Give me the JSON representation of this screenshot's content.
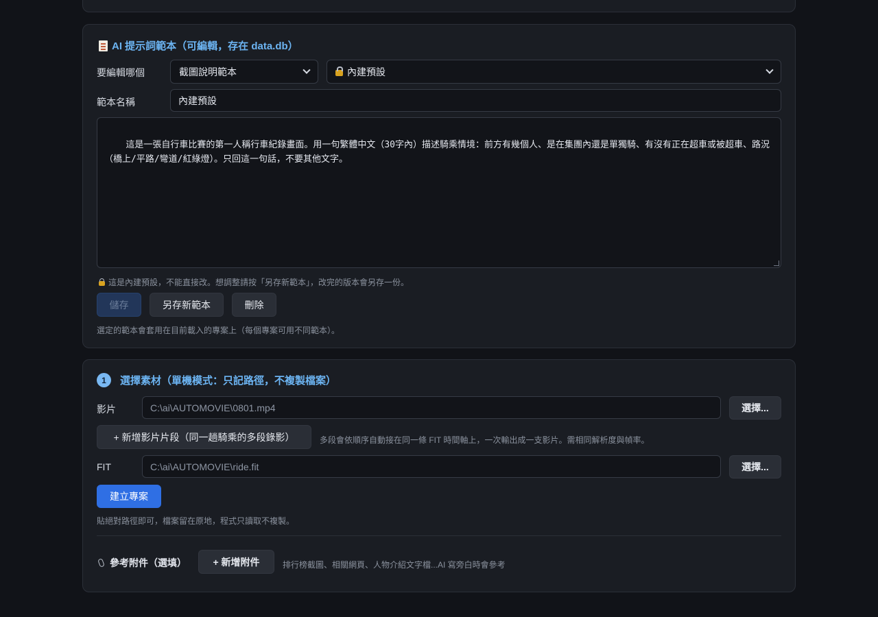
{
  "prompt_card": {
    "title": "AI 提示詞範本（可編輯，存在 data.db）",
    "edit_which_label": "要編輯哪個",
    "template_select": "截圖說明範本",
    "preset_select": "內建預設",
    "name_label": "範本名稱",
    "name_value": "內建預設",
    "prompt_text": "這是一張自行車比賽的第一人稱行車紀錄畫面。用一句繁體中文（30字內）描述騎乘情境：前方有幾個人、是在集團內還是單獨騎、有沒有正在超車或被超車、路況（橋上/平路/彎道/紅綠燈）。只回這一句話，不要其他文字。",
    "builtin_notice": "這是內建預設，不能直接改。想調整請按「另存新範本」，改完的版本會另存一份。",
    "save_button": "儲存",
    "save_as_button": "另存新範本",
    "delete_button": "刪除",
    "footer_hint": "選定的範本會套用在目前載入的專案上（每個專案可用不同範本）。"
  },
  "media_card": {
    "step_number": "1",
    "title": "選擇素材（單機模式：只記路徑，不複製檔案）",
    "video_label": "影片",
    "video_path": "C:\\ai\\AUTOMOVIE\\0801.mp4",
    "video_choose": "選擇...",
    "add_segment_button": "+ 新增影片片段（同一趟騎乘的多段錄影）",
    "add_segment_hint": "多段會依順序自動接在同一條 FIT 時間軸上，一次輸出成一支影片。需相同解析度與幀率。",
    "fit_label": "FIT",
    "fit_path": "C:\\ai\\AUTOMOVIE\\ride.fit",
    "fit_choose": "選擇...",
    "create_button": "建立專案",
    "path_hint": "貼絕對路徑即可，檔案留在原地，程式只讀取不複製。",
    "attachment_label": "參考附件（選填）",
    "add_attachment_button": "+ 新增附件",
    "attachment_hint": "排行榜截圖、相關網頁、人物介紹文字檔...AI 寫旁白時會參考"
  },
  "colors": {
    "accent": "#6cb4f2",
    "primary_button": "#2f6fe4",
    "lock": "#d8a21f"
  },
  "icons": [
    "document-icon",
    "lock-icon",
    "chevron-down-icon",
    "paperclip-icon"
  ]
}
